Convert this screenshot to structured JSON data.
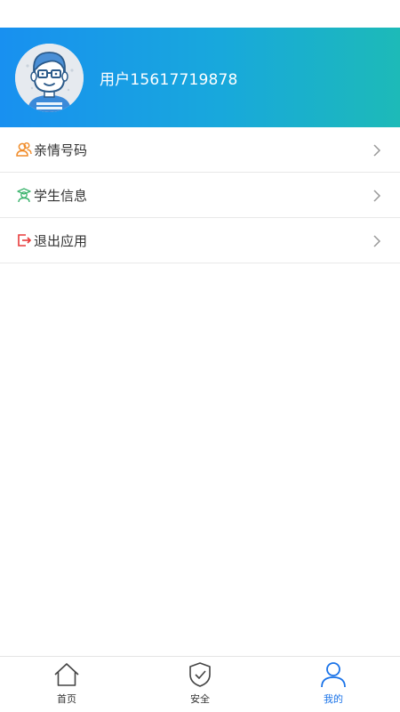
{
  "user": {
    "name": "用户15617719878"
  },
  "menu": {
    "items": [
      {
        "label": "亲情号码",
        "icon": "family-contacts-icon",
        "color": "#f08c2a"
      },
      {
        "label": "学生信息",
        "icon": "student-icon",
        "color": "#3cb46e"
      },
      {
        "label": "退出应用",
        "icon": "logout-icon",
        "color": "#e83a3a"
      }
    ]
  },
  "tabs": [
    {
      "label": "首页",
      "icon": "home-icon",
      "active": false
    },
    {
      "label": "安全",
      "icon": "shield-icon",
      "active": false
    },
    {
      "label": "我的",
      "icon": "user-icon",
      "active": true
    }
  ],
  "colors": {
    "header_gradient_start": "#1890f0",
    "header_gradient_end": "#1dbab8",
    "active_tab": "#1a73e8"
  }
}
